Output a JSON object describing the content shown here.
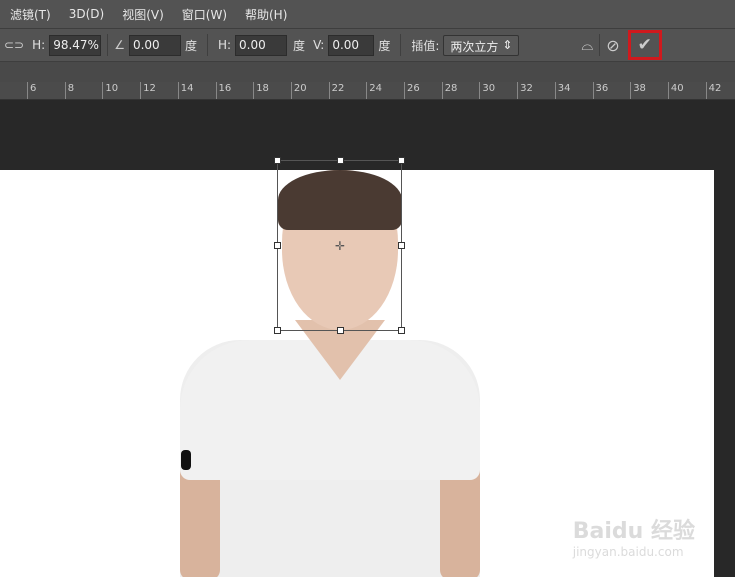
{
  "menu": [
    "滤镜(T)",
    "3D(D)",
    "视图(V)",
    "窗口(W)",
    "帮助(H)"
  ],
  "options": {
    "h_label": "H:",
    "h_value": "98.47%",
    "angle_value": "0.00",
    "deg": "度",
    "hskew_label": "H:",
    "hskew_value": "0.00",
    "v_label": "V:",
    "v_value": "0.00",
    "interp_label": "插值:",
    "interp_value": "两次立方"
  },
  "ruler": [
    "6",
    "8",
    "10",
    "12",
    "14",
    "16",
    "18",
    "20",
    "22",
    "24",
    "26",
    "28",
    "30",
    "32",
    "34",
    "36",
    "38",
    "40",
    "42"
  ],
  "watermark": {
    "brand": "Baidu 经验",
    "url": "jingyan.baidu.com"
  },
  "colors": {
    "highlight": "#d0191d"
  }
}
